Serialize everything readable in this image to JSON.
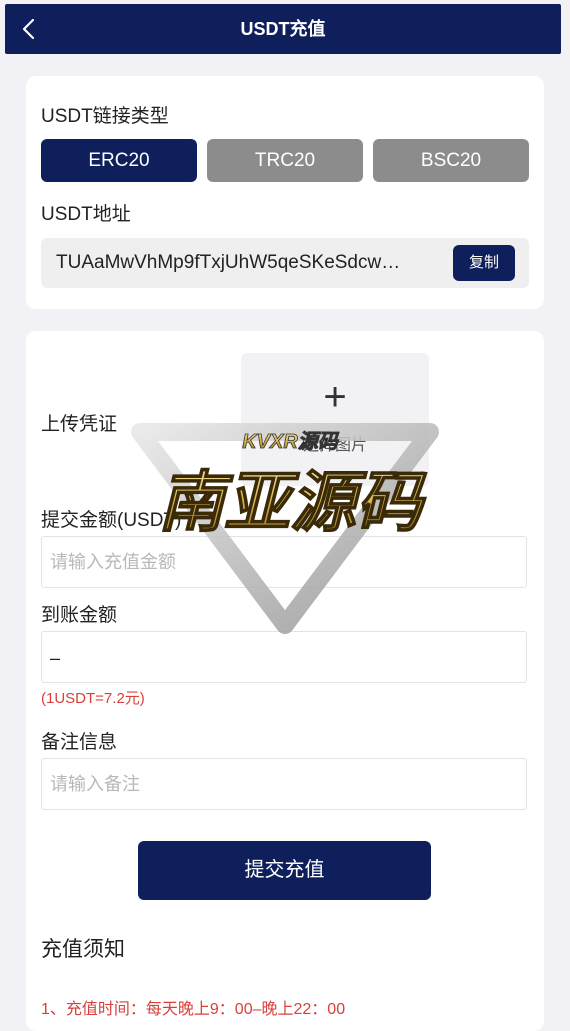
{
  "header": {
    "title": "USDT充值",
    "back_icon": "chevron-left-icon"
  },
  "chain": {
    "label": "USDT链接类型",
    "options": [
      {
        "label": "ERC20",
        "active": true
      },
      {
        "label": "TRC20",
        "active": false
      },
      {
        "label": "BSC20",
        "active": false
      }
    ]
  },
  "address": {
    "label": "USDT地址",
    "value": "TUAaMwVhMp9fTxjUhW5qeSKeSdcw…",
    "copy_label": "复制"
  },
  "upload": {
    "label": "上传凭证",
    "plus": "+",
    "button_text": "选择图片"
  },
  "amount": {
    "label": "提交金额(USDT)",
    "placeholder": "请输入充值金额"
  },
  "received": {
    "label": "到账金额",
    "value": "–",
    "rate": "(1USDT=7.2元)"
  },
  "remark": {
    "label": "备注信息",
    "placeholder": "请输入备注"
  },
  "submit_label": "提交充值",
  "notice": {
    "title": "充值须知",
    "items": [
      "1、充值时间：每天晚上9：00–晚上22：00"
    ]
  },
  "watermark": {
    "top_text": "KVXR源码",
    "main_text": "南亚源码"
  },
  "colors": {
    "primary": "#0f1f5c",
    "inactive": "#8c8c8c",
    "danger": "#d9403b"
  }
}
